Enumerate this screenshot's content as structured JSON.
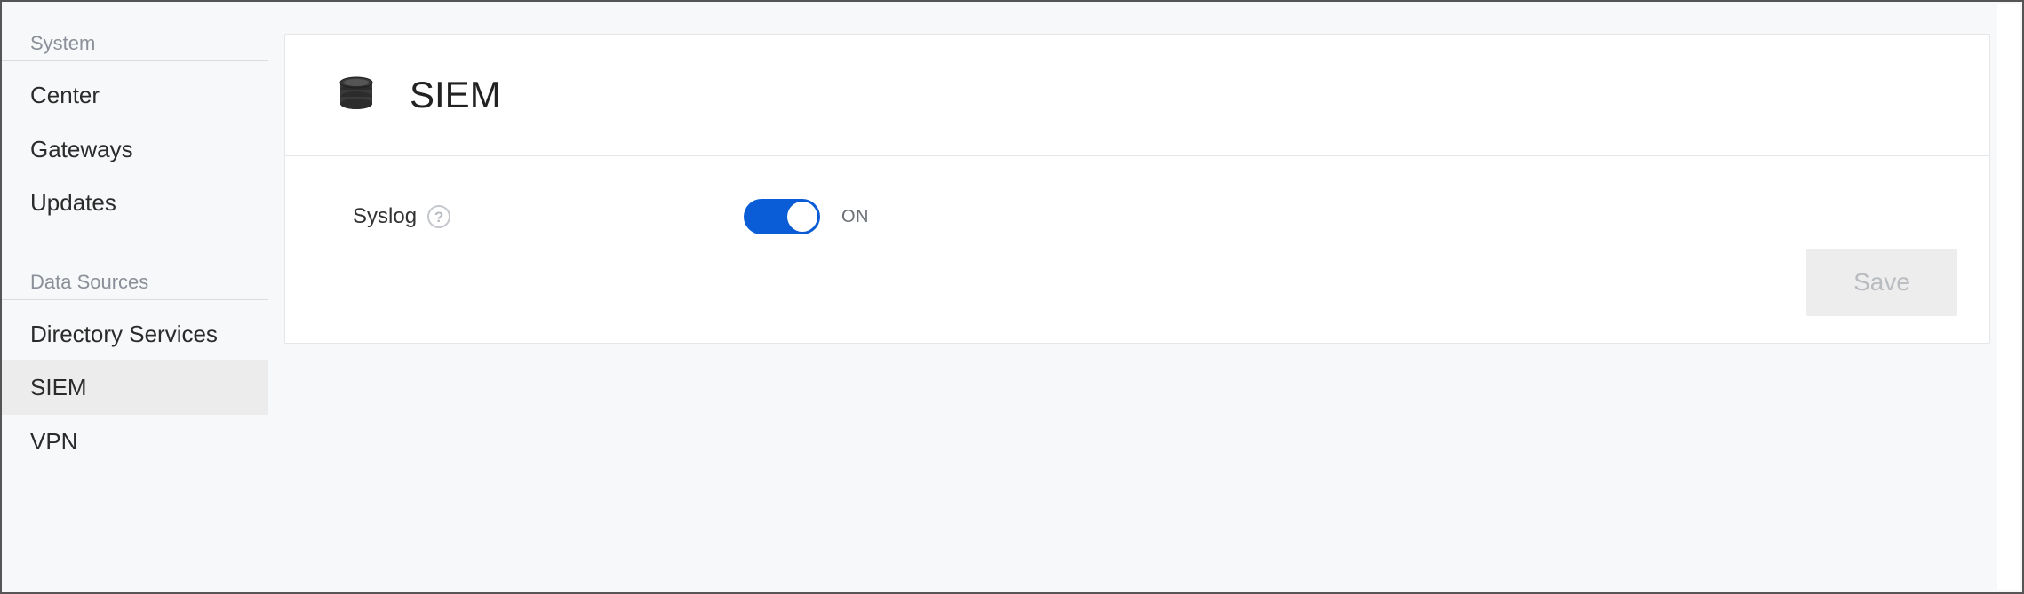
{
  "sidebar": {
    "groups": [
      {
        "header": "System",
        "items": [
          {
            "label": "Center"
          },
          {
            "label": "Gateways"
          },
          {
            "label": "Updates"
          }
        ]
      },
      {
        "header": "Data Sources",
        "items": [
          {
            "label": "Directory Services"
          },
          {
            "label": "SIEM"
          },
          {
            "label": "VPN"
          }
        ]
      }
    ]
  },
  "page": {
    "title": "SIEM",
    "settings": {
      "syslog": {
        "label": "Syslog",
        "state_text": "ON"
      }
    },
    "actions": {
      "save_label": "Save"
    }
  }
}
